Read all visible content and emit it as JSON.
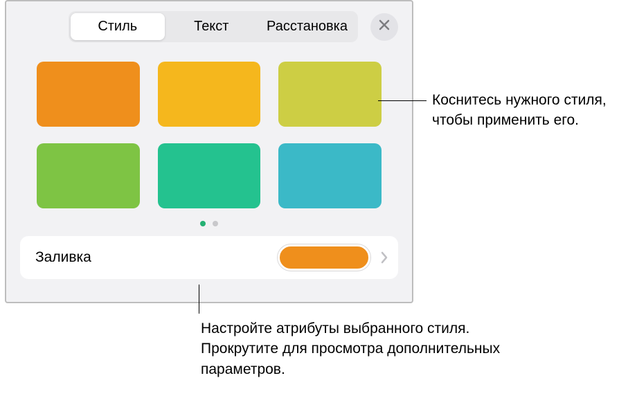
{
  "tabs": {
    "style": "Стиль",
    "text": "Текст",
    "arrange": "Расстановка"
  },
  "swatches": {
    "colors": [
      "#ef8f1c",
      "#f5b71d",
      "#cdce44",
      "#7ec444",
      "#24c28f",
      "#3bb9c7"
    ]
  },
  "fill": {
    "label": "Заливка",
    "color": "#ef8f1c"
  },
  "callouts": {
    "tap_style": "Коснитесь нужного стиля, чтобы применить его.",
    "adjust": "Настройте атрибуты выбранного стиля. Прокрутите для просмотра дополнительных параметров."
  }
}
